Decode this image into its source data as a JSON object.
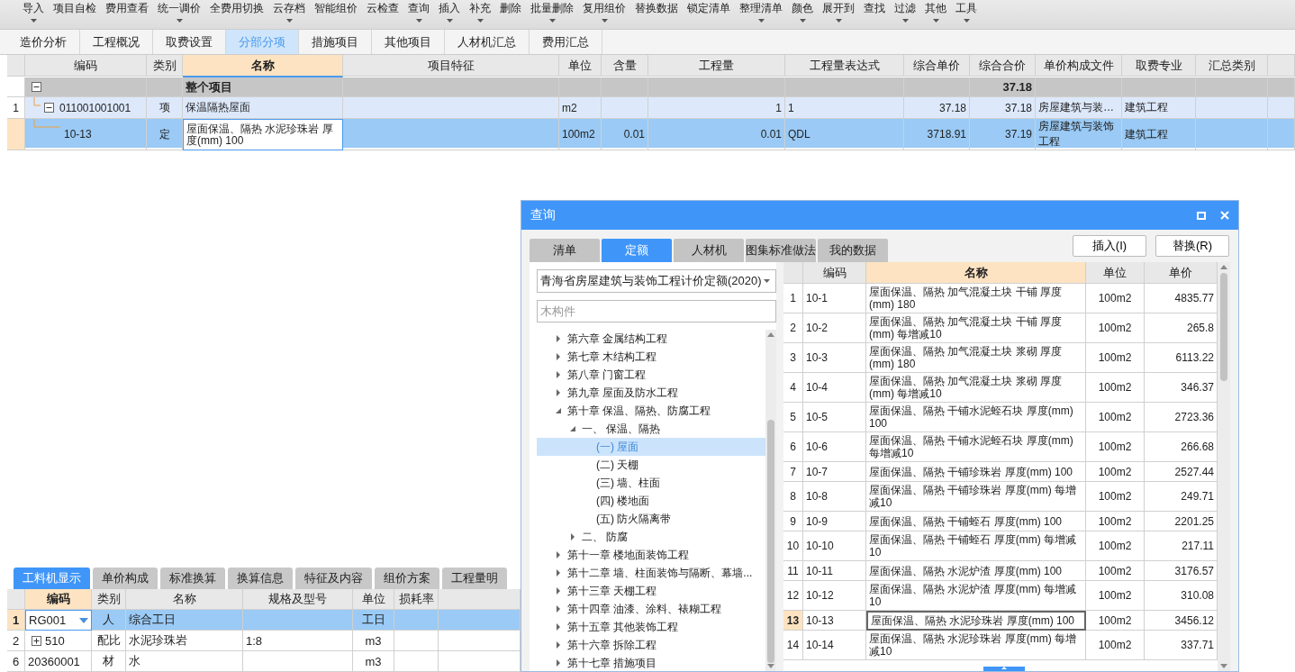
{
  "toolbar": [
    {
      "label": "导入",
      "dropdown": true
    },
    {
      "label": "项目自检",
      "dropdown": false
    },
    {
      "label": "费用查看",
      "dropdown": false
    },
    {
      "label": "统一调价",
      "dropdown": true
    },
    {
      "label": "全费用切换",
      "dropdown": false
    },
    {
      "label": "云存档",
      "dropdown": true
    },
    {
      "label": "智能组价",
      "dropdown": false
    },
    {
      "label": "云检查",
      "dropdown": false
    },
    {
      "label": "查询",
      "dropdown": true
    },
    {
      "label": "插入",
      "dropdown": true
    },
    {
      "label": "补充",
      "dropdown": true
    },
    {
      "label": "删除",
      "dropdown": false
    },
    {
      "label": "批量删除",
      "dropdown": true
    },
    {
      "label": "复用组价",
      "dropdown": true
    },
    {
      "label": "替换数据",
      "dropdown": false
    },
    {
      "label": "锁定清单",
      "dropdown": false
    },
    {
      "label": "整理清单",
      "dropdown": true
    },
    {
      "label": "颜色",
      "dropdown": true
    },
    {
      "label": "展开到",
      "dropdown": true
    },
    {
      "label": "查找",
      "dropdown": false
    },
    {
      "label": "过滤",
      "dropdown": true
    },
    {
      "label": "其他",
      "dropdown": true
    },
    {
      "label": "工具",
      "dropdown": true
    }
  ],
  "main_tabs": [
    {
      "label": "造价分析",
      "selected": false
    },
    {
      "label": "工程概况",
      "selected": false
    },
    {
      "label": "取费设置",
      "selected": false
    },
    {
      "label": "分部分项",
      "selected": true
    },
    {
      "label": "措施项目",
      "selected": false
    },
    {
      "label": "其他项目",
      "selected": false
    },
    {
      "label": "人材机汇总",
      "selected": false
    },
    {
      "label": "费用汇总",
      "selected": false
    }
  ],
  "main_table": {
    "columns": [
      {
        "label": "编码",
        "selected": false
      },
      {
        "label": "类别",
        "selected": false
      },
      {
        "label": "名称",
        "selected": true
      },
      {
        "label": "项目特征",
        "selected": false
      },
      {
        "label": "单位",
        "selected": false
      },
      {
        "label": "含量",
        "selected": false
      },
      {
        "label": "工程量",
        "selected": false
      },
      {
        "label": "工程量表达式",
        "selected": false
      },
      {
        "label": "综合单价",
        "selected": false
      },
      {
        "label": "综合合价",
        "selected": false
      },
      {
        "label": "单价构成文件",
        "selected": false
      },
      {
        "label": "取费专业",
        "selected": false
      },
      {
        "label": "汇总类别",
        "selected": false
      }
    ],
    "rows": [
      {
        "kind": "group",
        "expanded": true,
        "selected": false,
        "name": "整个项目",
        "total_price": "37.18"
      },
      {
        "kind": "bill",
        "expanded": true,
        "selected": false,
        "number": "1",
        "code": "011001001001",
        "type": "项",
        "name": "保温隔热屋面",
        "unit": "m2",
        "quantity": "1",
        "expression": "1",
        "unit_price": "37.18",
        "total_price": "37.18",
        "price_file": "房屋建筑与装…",
        "fee_type": "建筑工程"
      },
      {
        "kind": "quota",
        "selected": true,
        "code": "10-13",
        "type": "定",
        "name": "屋面保温、隔热 水泥珍珠岩 厚度(mm) 100",
        "unit": "100m2",
        "content": "0.01",
        "quantity": "0.01",
        "expression": "QDL",
        "unit_price": "3718.91",
        "total_price": "37.19",
        "price_file": "房屋建筑与装饰工程",
        "fee_type": "建筑工程"
      }
    ]
  },
  "bottom_tabs": [
    {
      "label": "工料机显示",
      "selected": true
    },
    {
      "label": "单价构成",
      "selected": false
    },
    {
      "label": "标准换算",
      "selected": false
    },
    {
      "label": "换算信息",
      "selected": false
    },
    {
      "label": "特征及内容",
      "selected": false
    },
    {
      "label": "组价方案",
      "selected": false
    },
    {
      "label": "工程量明",
      "selected": false
    }
  ],
  "bottom_table": {
    "columns": [
      {
        "label": "编码",
        "selected": true
      },
      {
        "label": "类别",
        "selected": false
      },
      {
        "label": "名称",
        "selected": false
      },
      {
        "label": "规格及型号",
        "selected": false
      },
      {
        "label": "单位",
        "selected": false
      },
      {
        "label": "损耗率",
        "selected": false
      }
    ],
    "rows": [
      {
        "number": "1",
        "code": "RG001",
        "type": "人",
        "name": "综合工日",
        "unit": "工日",
        "selected": true,
        "expandable": false
      },
      {
        "number": "2",
        "code": "510",
        "type": "配比",
        "name": "水泥珍珠岩",
        "spec": "1:8",
        "unit": "m3",
        "selected": false,
        "expandable": true
      },
      {
        "number": "6",
        "code": "20360001",
        "type": "材",
        "name": "水",
        "unit": "m3",
        "selected": false,
        "expandable": false
      }
    ]
  },
  "dialog": {
    "title": "查询",
    "tabs": [
      {
        "label": "清单",
        "selected": false
      },
      {
        "label": "定额",
        "selected": true
      },
      {
        "label": "人材机",
        "selected": false
      },
      {
        "label": "图集标准做法",
        "selected": false
      },
      {
        "label": "我的数据",
        "selected": false
      }
    ],
    "buttons": [
      "插入(I)",
      "替换(R)"
    ],
    "library": "青海省房屋建筑与装饰工程计价定额(2020)",
    "search": {
      "placeholder": "木构件"
    },
    "tree": [
      {
        "label": "第六章 金属结构工程",
        "expanded": false
      },
      {
        "label": "第七章 木结构工程",
        "expanded": false
      },
      {
        "label": "第八章 门窗工程",
        "expanded": false
      },
      {
        "label": "第九章 屋面及防水工程",
        "expanded": false
      },
      {
        "label": "第十章 保温、隔热、防腐工程",
        "expanded": true,
        "children": [
          {
            "label": "一、 保温、隔热",
            "expanded": true,
            "children": [
              {
                "label": "(一) 屋面",
                "selected": true
              },
              {
                "label": "(二) 天棚",
                "selected": false
              },
              {
                "label": "(三) 墙、柱面",
                "selected": false
              },
              {
                "label": "(四) 楼地面",
                "selected": false
              },
              {
                "label": "(五) 防火隔离带",
                "selected": false
              }
            ]
          },
          {
            "label": "二、 防腐",
            "expanded": false
          }
        ]
      },
      {
        "label": "第十一章 楼地面装饰工程",
        "expanded": false
      },
      {
        "label": "第十二章 墙、柱面装饰与隔断、幕墙...",
        "expanded": false
      },
      {
        "label": "第十三章 天棚工程",
        "expanded": false
      },
      {
        "label": "第十四章 油漆、涂料、裱糊工程",
        "expanded": false
      },
      {
        "label": "第十五章 其他装饰工程",
        "expanded": false
      },
      {
        "label": "第十六章 拆除工程",
        "expanded": false
      },
      {
        "label": "第十七章 措施项目",
        "expanded": false
      }
    ],
    "table": {
      "columns": [
        {
          "label": "编码",
          "selected": false
        },
        {
          "label": "名称",
          "selected": true
        },
        {
          "label": "单位",
          "selected": false
        },
        {
          "label": "单价",
          "selected": false
        }
      ],
      "rows": [
        {
          "number": "1",
          "code": "10-1",
          "name": "屋面保温、隔热 加气混凝土块 干铺 厚度(mm) 180",
          "unit": "100m2",
          "price": "4835.77",
          "selected": false
        },
        {
          "number": "2",
          "code": "10-2",
          "name": "屋面保温、隔热 加气混凝土块 干铺 厚度(mm) 每增减10",
          "unit": "100m2",
          "price": "265.8",
          "selected": false
        },
        {
          "number": "3",
          "code": "10-3",
          "name": "屋面保温、隔热 加气混凝土块 浆砌 厚度(mm) 180",
          "unit": "100m2",
          "price": "6113.22",
          "selected": false
        },
        {
          "number": "4",
          "code": "10-4",
          "name": "屋面保温、隔热 加气混凝土块 浆砌 厚度(mm) 每增减10",
          "unit": "100m2",
          "price": "346.37",
          "selected": false
        },
        {
          "number": "5",
          "code": "10-5",
          "name": "屋面保温、隔热 干铺水泥蛭石块 厚度(mm) 100",
          "unit": "100m2",
          "price": "2723.36",
          "selected": false
        },
        {
          "number": "6",
          "code": "10-6",
          "name": "屋面保温、隔热 干铺水泥蛭石块 厚度(mm) 每增减10",
          "unit": "100m2",
          "price": "266.68",
          "selected": false
        },
        {
          "number": "7",
          "code": "10-7",
          "name": "屋面保温、隔热 干铺珍珠岩 厚度(mm) 100",
          "unit": "100m2",
          "price": "2527.44",
          "selected": false
        },
        {
          "number": "8",
          "code": "10-8",
          "name": "屋面保温、隔热 干铺珍珠岩 厚度(mm) 每增减10",
          "unit": "100m2",
          "price": "249.71",
          "selected": false
        },
        {
          "number": "9",
          "code": "10-9",
          "name": "屋面保温、隔热 干铺蛭石 厚度(mm) 100",
          "unit": "100m2",
          "price": "2201.25",
          "selected": false
        },
        {
          "number": "10",
          "code": "10-10",
          "name": "屋面保温、隔热 干铺蛭石 厚度(mm) 每增减10",
          "unit": "100m2",
          "price": "217.11",
          "selected": false
        },
        {
          "number": "11",
          "code": "10-11",
          "name": "屋面保温、隔热 水泥炉渣 厚度(mm) 100",
          "unit": "100m2",
          "price": "3176.57",
          "selected": false
        },
        {
          "number": "12",
          "code": "10-12",
          "name": "屋面保温、隔热 水泥炉渣 厚度(mm) 每增减10",
          "unit": "100m2",
          "price": "310.08",
          "selected": false
        },
        {
          "number": "13",
          "code": "10-13",
          "name": "屋面保温、隔热 水泥珍珠岩 厚度(mm) 100",
          "unit": "100m2",
          "price": "3456.12",
          "selected": true
        },
        {
          "number": "14",
          "code": "10-14",
          "name": "屋面保温、隔热 水泥珍珠岩 厚度(mm) 每增减10",
          "unit": "100m2",
          "price": "337.71",
          "selected": false
        }
      ]
    }
  }
}
